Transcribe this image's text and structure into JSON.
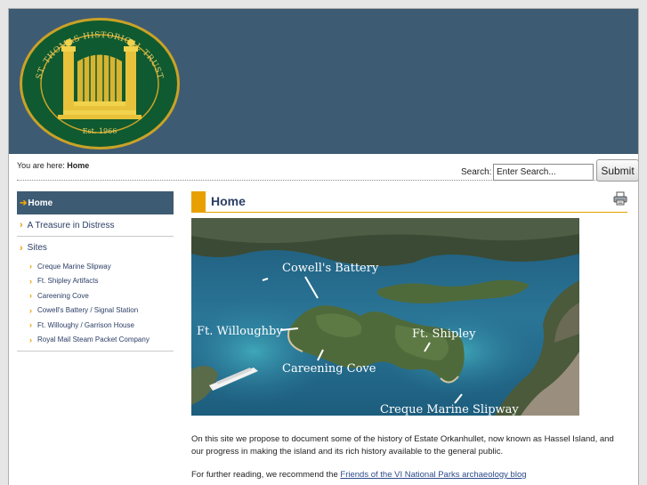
{
  "header": {
    "logo": {
      "ring_text": "ST. THOMAS HISTORICAL TRUST",
      "est": "Est. 1966"
    }
  },
  "breadcrumb": {
    "prefix": "You are here:",
    "current": "Home"
  },
  "search": {
    "label": "Search:",
    "value": "Enter Search...",
    "button": "Submit"
  },
  "sidebar": {
    "items": [
      {
        "label": "Home"
      },
      {
        "label": "A Treasure in Distress"
      },
      {
        "label": "Sites"
      }
    ],
    "sites": [
      {
        "label": "Creque Marine Slipway"
      },
      {
        "label": "Ft. Shipley Artifacts"
      },
      {
        "label": "Careening Cove"
      },
      {
        "label": "Cowell's Battery / Signal Station"
      },
      {
        "label": "Ft. Willoughy / Garrison House"
      },
      {
        "label": "Royal Mail Steam Packet Company"
      }
    ]
  },
  "main": {
    "title": "Home",
    "photo_labels": {
      "cowell": "Cowell's Battery",
      "willoughby": "Ft. Willoughby",
      "shipley": "Ft. Shipley",
      "careening": "Careening Cove",
      "creque": "Creque Marine Slipway"
    },
    "paragraph1": "On this site we propose to document some of the history of Estate Orkanhullet, now known as Hassel Island, and our progress in making the island and its rich history available to the general public.",
    "paragraph2_prefix": "For further reading, we recommend the ",
    "paragraph2_link": "Friends of the VI National Parks archaeology blog"
  },
  "colors": {
    "header_blue": "#3e5b74",
    "accent_orange": "#e8a000",
    "nav_text": "#2c3e66"
  }
}
